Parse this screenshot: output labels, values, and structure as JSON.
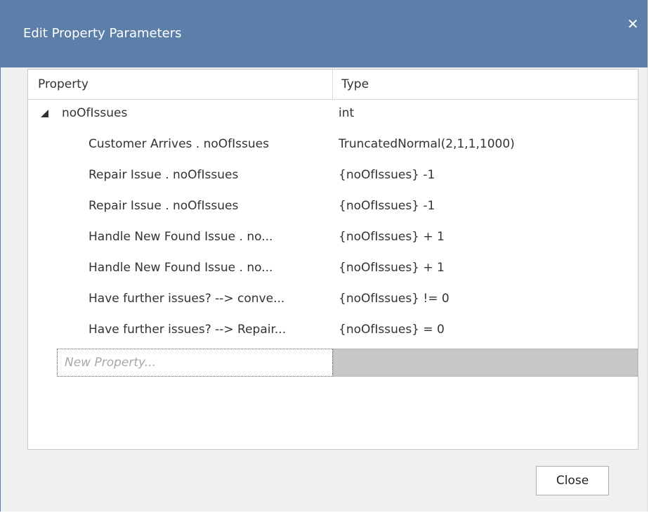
{
  "window": {
    "title": "Edit Property Parameters",
    "close_glyph": "✕"
  },
  "grid": {
    "columns": [
      "Property",
      "Type"
    ],
    "parent": {
      "property": "noOfIssues",
      "type": "int",
      "expanded": true
    },
    "rows": [
      {
        "property": "Customer Arrives . noOfIssues",
        "type": "TruncatedNormal(2,1,1,1000)"
      },
      {
        "property": "Repair Issue . noOfIssues",
        "type": "{noOfIssues} -1"
      },
      {
        "property": "Repair Issue . noOfIssues",
        "type": "{noOfIssues} -1"
      },
      {
        "property": "Handle New Found Issue . no...",
        "type": "{noOfIssues} + 1"
      },
      {
        "property": "Handle New Found Issue . no...",
        "type": "{noOfIssues} + 1"
      },
      {
        "property": "Have further issues? --> conve...",
        "type": "{noOfIssues} != 0"
      },
      {
        "property": "Have further issues? --> Repair...",
        "type": "{noOfIssues} = 0"
      }
    ],
    "new_property_placeholder": "New Property..."
  },
  "buttons": {
    "close_label": "Close"
  },
  "colors": {
    "titlebar": "#5b7fa8",
    "dialog_bg": "#f0f0f0",
    "selected_cell": "#c8c8c8"
  },
  "icons": {
    "expander": "expanded-triangle-icon",
    "close": "close-icon"
  }
}
